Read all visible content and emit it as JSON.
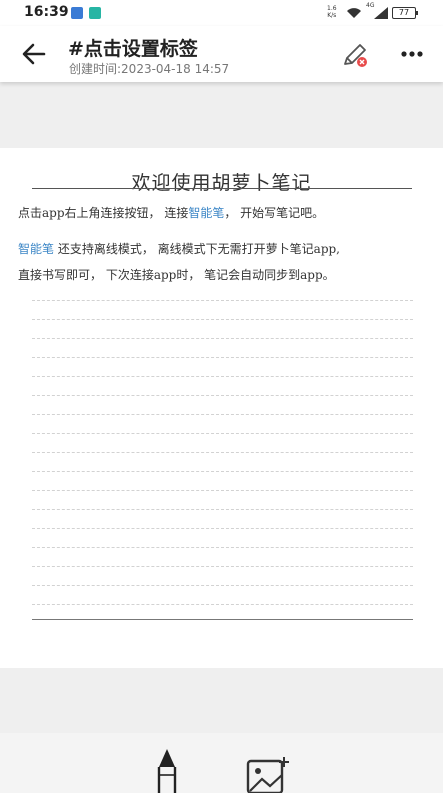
{
  "status_bar": {
    "time": "16:39",
    "net_speed_value": "1.6",
    "net_speed_unit": "K/s",
    "network": "4G",
    "battery": "77"
  },
  "header": {
    "title": "#点击设置标签",
    "created": "创建时间:2023-04-18 14:57"
  },
  "note": {
    "title": "欢迎使用胡萝卜笔记",
    "line1_a": "点击app右上角连接按钮， 连接",
    "line1_blue": "智能笔",
    "line1_b": "， 开始写笔记吧。",
    "line2_blue": "智能笔",
    "line2_b": "还支持离线模式， 离线模式下无需打开萝卜笔记app,",
    "line3": "直接书写即可， 下次连接app时， 笔记会自动同步到app。",
    "accent_color": "#3b86c6"
  },
  "toolbar": {
    "tools": [
      "pen-tool",
      "insert-image"
    ]
  }
}
